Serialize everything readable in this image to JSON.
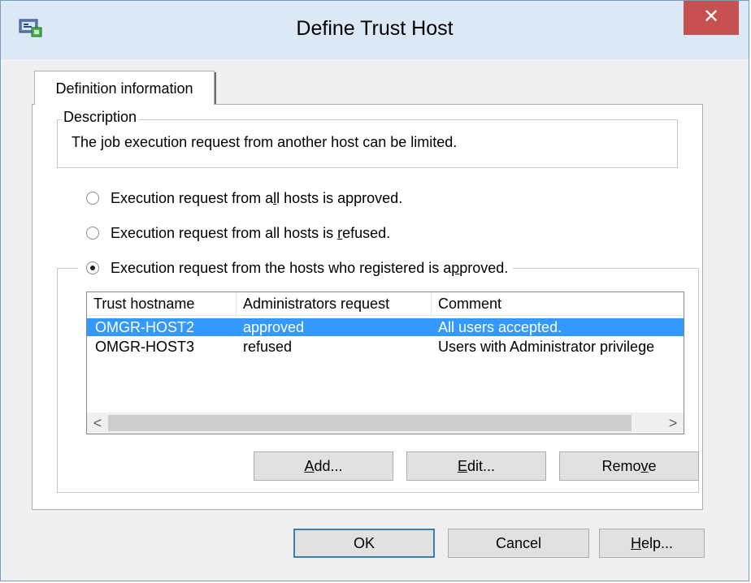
{
  "window": {
    "title": "Define Trust Host",
    "close_label": "✕"
  },
  "tab": {
    "label": "Definition information"
  },
  "description": {
    "legend": "Description",
    "text": "The job execution request from another host can be limited."
  },
  "radios": [
    {
      "before": "Execution request from a",
      "accel": "l",
      "after": "l hosts is approved.",
      "checked": false
    },
    {
      "before": "Execution request from all hosts is ",
      "accel": "r",
      "after": "efused.",
      "checked": false
    },
    {
      "before": "Execution request from the hosts who registered is a",
      "accel": "p",
      "after": "proved.",
      "checked": true
    }
  ],
  "table": {
    "columns": [
      "Trust hostname",
      "Administrators request",
      "Comment"
    ],
    "rows": [
      {
        "host": "OMGR-HOST2",
        "request": "approved",
        "comment": "All users accepted.",
        "selected": true
      },
      {
        "host": "OMGR-HOST3",
        "request": "refused",
        "comment": "Users with Administrator privilege",
        "selected": false
      }
    ],
    "scroll_left": "<",
    "scroll_right": ">"
  },
  "list_buttons": {
    "add": {
      "accel": "A",
      "rest": "dd..."
    },
    "edit": {
      "accel": "E",
      "rest": "dit..."
    },
    "remove": {
      "before": "Remo",
      "accel": "v",
      "after": "e"
    }
  },
  "dialog_buttons": {
    "ok": "OK",
    "cancel": "Cancel",
    "help": {
      "accel": "H",
      "rest": "elp..."
    }
  },
  "colors": {
    "selection": "#3399ff",
    "close_button": "#c75050",
    "titlebar": "#dbe8f5"
  }
}
